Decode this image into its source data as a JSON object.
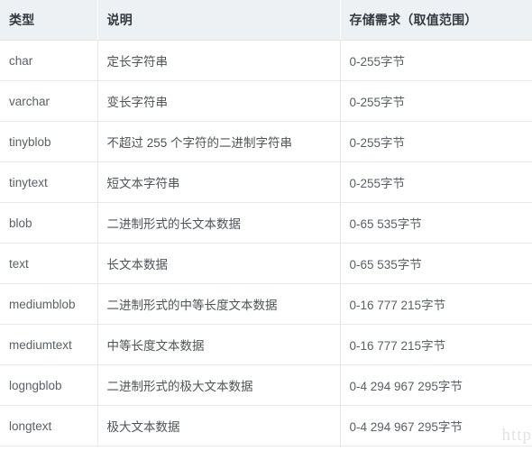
{
  "table": {
    "columns": [
      {
        "key": "type",
        "label": "类型"
      },
      {
        "key": "desc",
        "label": "说明"
      },
      {
        "key": "store",
        "label": "存储需求（取值范围）"
      }
    ],
    "rows": [
      {
        "type": "char",
        "desc": "定长字符串",
        "store": "0-255字节"
      },
      {
        "type": "varchar",
        "desc": "变长字符串",
        "store": "0-255字节"
      },
      {
        "type": "tinyblob",
        "desc": "不超过 255 个字符的二进制字符串",
        "store": "0-255字节"
      },
      {
        "type": "tinytext",
        "desc": "短文本字符串",
        "store": "0-255字节"
      },
      {
        "type": "blob",
        "desc": "二进制形式的长文本数据",
        "store": "0-65 535字节"
      },
      {
        "type": "text",
        "desc": "长文本数据",
        "store": "0-65 535字节"
      },
      {
        "type": "mediumblob",
        "desc": "二进制形式的中等长度文本数据",
        "store": "0-16 777 215字节"
      },
      {
        "type": "mediumtext",
        "desc": "中等长度文本数据",
        "store": "0-16 777 215字节"
      },
      {
        "type": "logngblob",
        "desc": "二进制形式的极大文本数据",
        "store": "0-4 294 967 295字节"
      },
      {
        "type": "longtext",
        "desc": "极大文本数据",
        "store": "0-4 294 967 295字节"
      }
    ]
  },
  "watermark": {
    "text": "http"
  },
  "colors": {
    "header_background": "#edf1f4",
    "header_text": "#333940",
    "body_text": "#5b6066",
    "row_border": "#e6e8ea",
    "header_divider": "#ffffff",
    "page_background": "#ffffff",
    "watermark_text": "#e3e3e3"
  }
}
